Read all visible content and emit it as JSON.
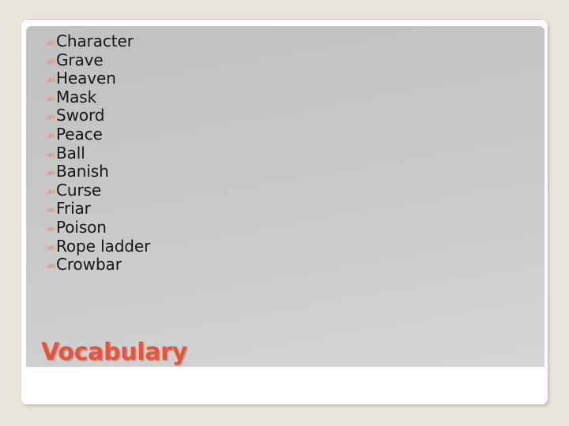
{
  "slide": {
    "title": "Vocabulary",
    "bullet_glyph": "❧",
    "bullet_icon_name": "floral-heart-bullet-icon",
    "colors": {
      "page_background": "#e9e5dc",
      "card_background": "#ffffff",
      "panel_gradient_start": "#c1c1c1",
      "panel_gradient_end": "#d6d6d6",
      "title_color": "#e8533c",
      "bullet_color": "#e2a08c",
      "text_color": "#161616"
    },
    "vocabulary_items": [
      {
        "label": "Character"
      },
      {
        "label": "Grave"
      },
      {
        "label": "Heaven"
      },
      {
        "label": "Mask"
      },
      {
        "label": "Sword"
      },
      {
        "label": "Peace"
      },
      {
        "label": "Ball"
      },
      {
        "label": "Banish"
      },
      {
        "label": "Curse"
      },
      {
        "label": "Friar"
      },
      {
        "label": "Poison"
      },
      {
        "label": "Rope ladder"
      },
      {
        "label": "Crowbar"
      }
    ]
  }
}
